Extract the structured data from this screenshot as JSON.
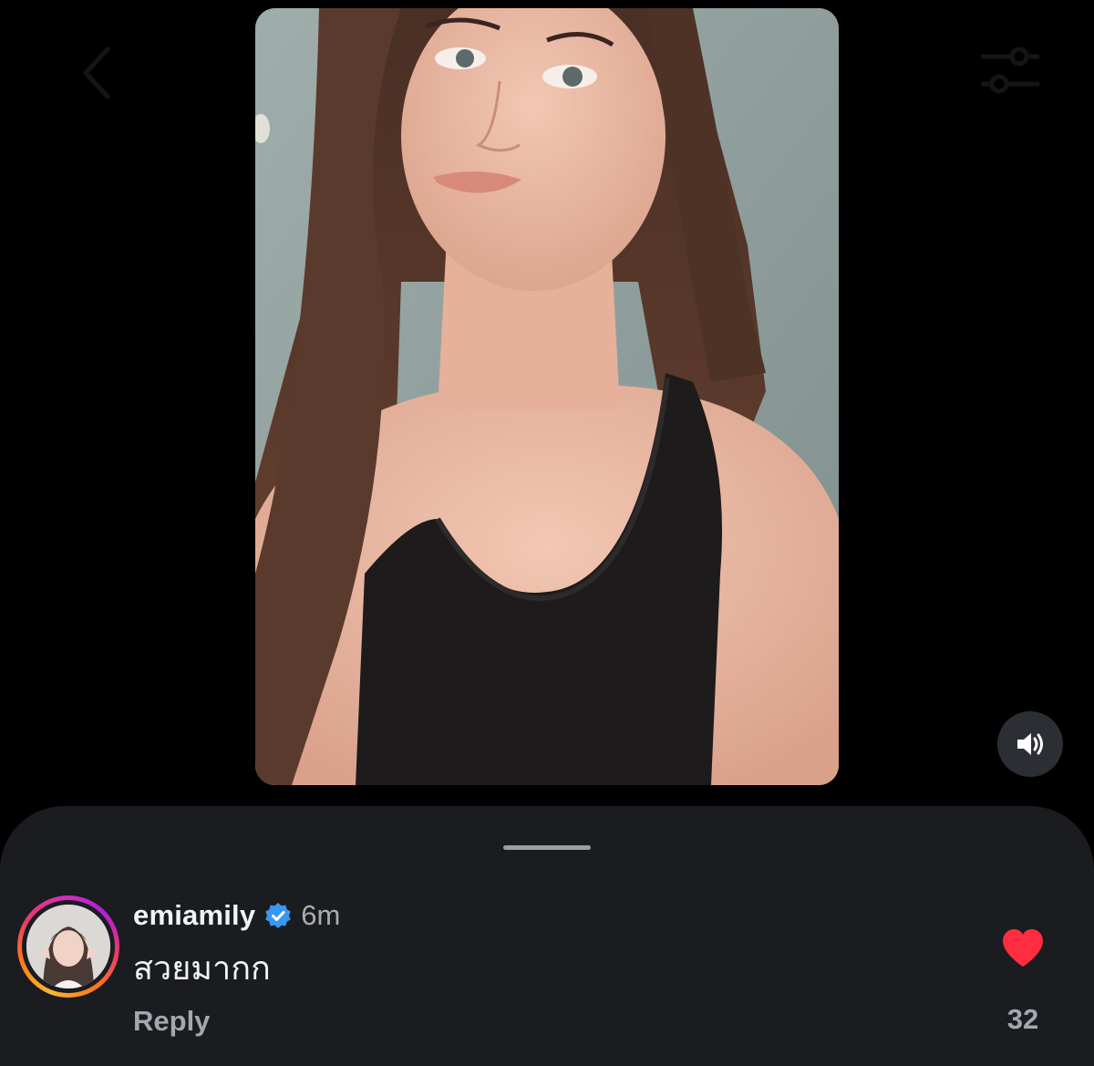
{
  "media": {
    "kind": "photo",
    "subject": "portrait"
  },
  "controls": {
    "back_icon": "chevron-left-icon",
    "filter_icon": "sliders-icon",
    "volume_icon": "speaker-icon"
  },
  "comment": {
    "username": "emiamily",
    "verified": true,
    "time": "6m",
    "text": "สวยมากก",
    "reply_label": "Reply",
    "like_count": "32",
    "liked": true
  },
  "colors": {
    "like": "#ff2d3f",
    "verified": "#3897f0",
    "sheet": "#1a1c20"
  }
}
